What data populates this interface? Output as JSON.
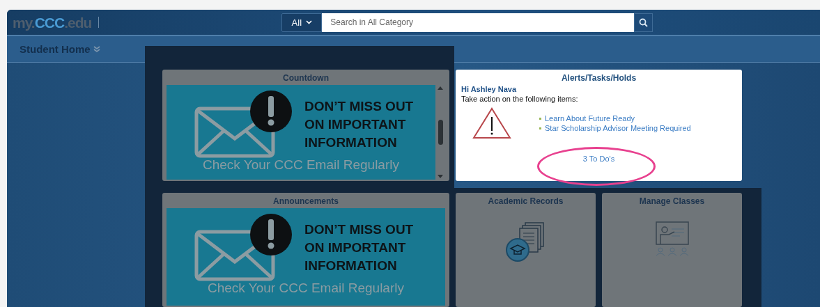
{
  "header": {
    "logo": {
      "prefix": "my.",
      "middle": "CCC",
      "suffix": ".edu"
    },
    "search": {
      "category": "All",
      "placeholder": "Search in All Category"
    }
  },
  "page_title": "Student Home",
  "tiles": [
    {
      "kind": "banner",
      "title": "Countdown",
      "headline": [
        "DON’T MISS OUT",
        "ON IMPORTANT",
        "INFORMATION"
      ],
      "caption": "Check Your CCC Email Regularly",
      "highlighted": false,
      "scrollable": true
    },
    {
      "kind": "alerts",
      "title": "Alerts/Tasks/Holds",
      "greeting": "Hi Ashley Nava",
      "instruction": "Take action on the following items:",
      "items": [
        "Learn About Future Ready",
        "Star Scholarship Advisor Meeting Required"
      ],
      "todo": "3 To Do's",
      "highlighted": true,
      "circled": true
    },
    {
      "kind": "banner",
      "title": "Announcements",
      "headline": [
        "DON’T MISS OUT",
        "ON IMPORTANT",
        "INFORMATION"
      ],
      "caption": "Check Your CCC Email Regularly",
      "highlighted": false,
      "scrollable": false
    },
    {
      "kind": "records",
      "title": "Academic Records",
      "highlighted": false
    },
    {
      "kind": "classes",
      "title": "Manage Classes",
      "highlighted": false
    }
  ]
}
